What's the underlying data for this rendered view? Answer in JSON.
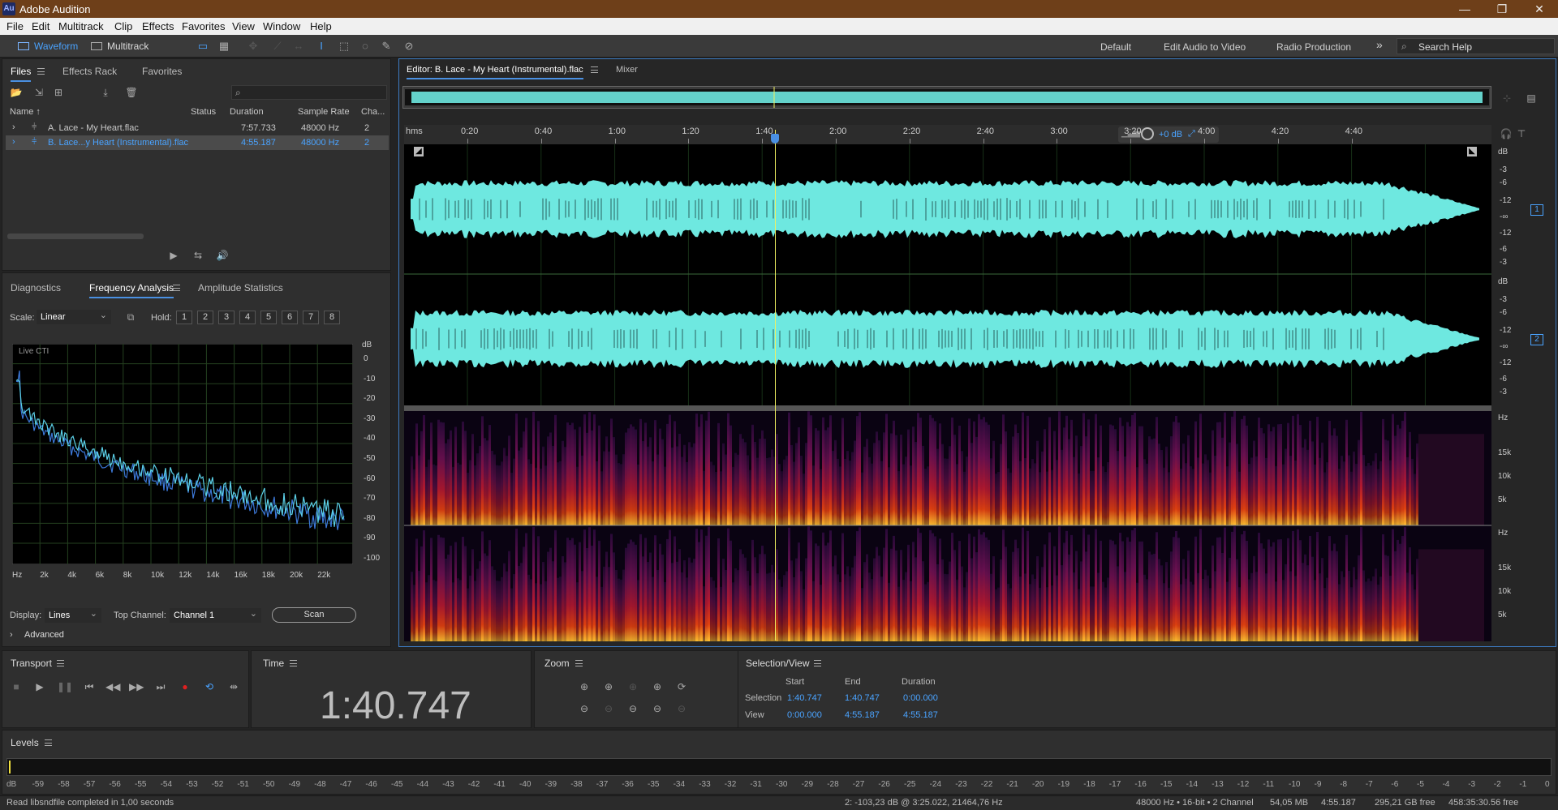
{
  "app": {
    "title": "Adobe Audition",
    "logo": "Au"
  },
  "window_controls": [
    "—",
    "❐",
    "✕"
  ],
  "menu": [
    "File",
    "Edit",
    "Multitrack",
    "Clip",
    "Effects",
    "Favorites",
    "View",
    "Window",
    "Help"
  ],
  "toolbar": {
    "waveform": "Waveform",
    "multitrack": "Multitrack",
    "workspaces": [
      "Default",
      "Edit Audio to Video",
      "Radio Production"
    ],
    "more": "»",
    "search_placeholder": "Search Help"
  },
  "files_panel": {
    "tabs": [
      "Files",
      "Effects Rack",
      "Favorites"
    ],
    "columns": [
      "Name ↑",
      "Status",
      "Duration",
      "Sample Rate",
      "Cha..."
    ],
    "rows": [
      {
        "name": "A. Lace - My Heart.flac",
        "status": "",
        "duration": "7:57.733",
        "rate": "48000 Hz",
        "ch": "2"
      },
      {
        "name": "B. Lace...y Heart (Instrumental).flac",
        "status": "",
        "duration": "4:55.187",
        "rate": "48000 Hz",
        "ch": "2"
      }
    ]
  },
  "analysis_panel": {
    "tabs": [
      "Diagnostics",
      "Frequency Analysis",
      "Amplitude Statistics"
    ],
    "scale_label": "Scale:",
    "scale_value": "Linear",
    "hold_label": "Hold:",
    "hold": [
      {
        "n": "1",
        "c": "#e0201c"
      },
      {
        "n": "2",
        "c": "#f08a10"
      },
      {
        "n": "3",
        "c": "#f0e010"
      },
      {
        "n": "4",
        "c": "#58d020"
      },
      {
        "n": "5",
        "c": "#20c040"
      },
      {
        "n": "6",
        "c": "#20c0c0"
      },
      {
        "n": "7",
        "c": "#2090f0"
      },
      {
        "n": "8",
        "c": "#e020d0"
      }
    ],
    "live_label": "Live CTI",
    "db_unit": "dB",
    "db_ticks": [
      "0",
      "-10",
      "-20",
      "-30",
      "-40",
      "-50",
      "-60",
      "-70",
      "-80",
      "-90",
      "-100"
    ],
    "freq_ticks": [
      "Hz",
      "2k",
      "4k",
      "6k",
      "8k",
      "10k",
      "12k",
      "14k",
      "16k",
      "18k",
      "20k",
      "22k"
    ],
    "display_label": "Display:",
    "display_value": "Lines",
    "top_channel_label": "Top Channel:",
    "top_channel_value": "Channel 1",
    "scan": "Scan",
    "advanced": "Advanced"
  },
  "editor": {
    "tabs": [
      "Editor: B. Lace - My Heart (Instrumental).flac",
      "Mixer"
    ],
    "time_unit": "hms",
    "time_ticks": [
      "0:20",
      "0:40",
      "1:00",
      "1:20",
      "1:40",
      "2:00",
      "2:20",
      "2:40",
      "3:00",
      "3:20",
      "4:00",
      "4:20",
      "4:40"
    ],
    "hud_gain": "+0 dB",
    "db_unit": "dB",
    "db_scale": [
      "-3",
      "-6",
      "-12",
      "-∞",
      "-12",
      "-6",
      "-3"
    ],
    "channels": [
      "1",
      "2"
    ],
    "hz_unit": "Hz",
    "hz_scale": [
      "15k",
      "10k",
      "5k"
    ],
    "playhead_fraction": 0.3413
  },
  "transport": {
    "title": "Transport",
    "buttons": [
      "stop",
      "play",
      "pause",
      "prev",
      "rewind",
      "fast-forward",
      "next",
      "record",
      "loop",
      "skip"
    ]
  },
  "time_panel": {
    "title": "Time",
    "value": "1:40.747"
  },
  "zoom": {
    "title": "Zoom"
  },
  "selection_view": {
    "title": "Selection/View",
    "headers": [
      "Start",
      "End",
      "Duration"
    ],
    "selection_label": "Selection",
    "selection": [
      "1:40.747",
      "1:40.747",
      "0:00.000"
    ],
    "view_label": "View",
    "view": [
      "0:00.000",
      "4:55.187",
      "4:55.187"
    ]
  },
  "levels": {
    "title": "Levels",
    "ticks": [
      "dB",
      "-59",
      "-58",
      "-57",
      "-56",
      "-55",
      "-54",
      "-53",
      "-52",
      "-51",
      "-50",
      "-49",
      "-48",
      "-47",
      "-46",
      "-45",
      "-44",
      "-43",
      "-42",
      "-41",
      "-40",
      "-39",
      "-38",
      "-37",
      "-36",
      "-35",
      "-34",
      "-33",
      "-32",
      "-31",
      "-30",
      "-29",
      "-28",
      "-27",
      "-26",
      "-25",
      "-24",
      "-23",
      "-22",
      "-21",
      "-20",
      "-19",
      "-18",
      "-17",
      "-16",
      "-15",
      "-14",
      "-13",
      "-12",
      "-11",
      "-10",
      "-9",
      "-8",
      "-7",
      "-6",
      "-5",
      "-4",
      "-3",
      "-2",
      "-1",
      "0"
    ]
  },
  "status": {
    "message": "Read libsndfile completed in 1,00 seconds",
    "cursor": "2: -103,23 dB @ 3:25.022, 21464,76 Hz",
    "format": "48000 Hz • 16-bit • 2 Channel",
    "size": "54,05 MB",
    "duration": "4:55.187",
    "free": "295,21 GB free",
    "free_time": "458:35:30.56 free"
  },
  "colors": {
    "waveform": "#6ee8e0",
    "accent": "#4a90e2",
    "playhead": "#f0f060"
  }
}
